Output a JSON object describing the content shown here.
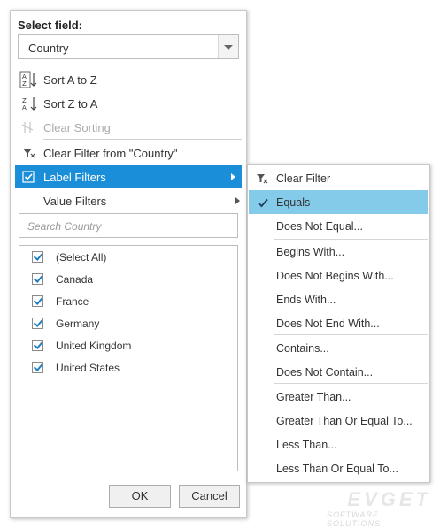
{
  "panel": {
    "select_label": "Select field:",
    "field_value": "Country",
    "menu": {
      "sort_az": "Sort A to Z",
      "sort_za": "Sort Z to A",
      "clear_sorting": "Clear Sorting",
      "clear_filter": "Clear Filter from \"Country\"",
      "label_filters": "Label Filters",
      "value_filters": "Value Filters"
    },
    "search_placeholder": "Search Country",
    "items": [
      "(Select All)",
      "Canada",
      "France",
      "Germany",
      "United Kingdom",
      "United States"
    ],
    "ok_label": "OK",
    "cancel_label": "Cancel"
  },
  "submenu": {
    "items": [
      "Clear Filter",
      "Equals",
      "Does Not Equal...",
      "Begins With...",
      "Does Not Begins With...",
      "Ends With...",
      "Does Not End With...",
      "Contains...",
      "Does Not Contain...",
      "Greater Than...",
      "Greater Than Or Equal To...",
      "Less Than...",
      "Less Than Or Equal To..."
    ]
  },
  "logo": {
    "name": "EVGET",
    "tagline": "SOFTWARE SOLUTIONS"
  },
  "colors": {
    "accent": "#1a8ed8",
    "selected": "#83cbe9"
  }
}
